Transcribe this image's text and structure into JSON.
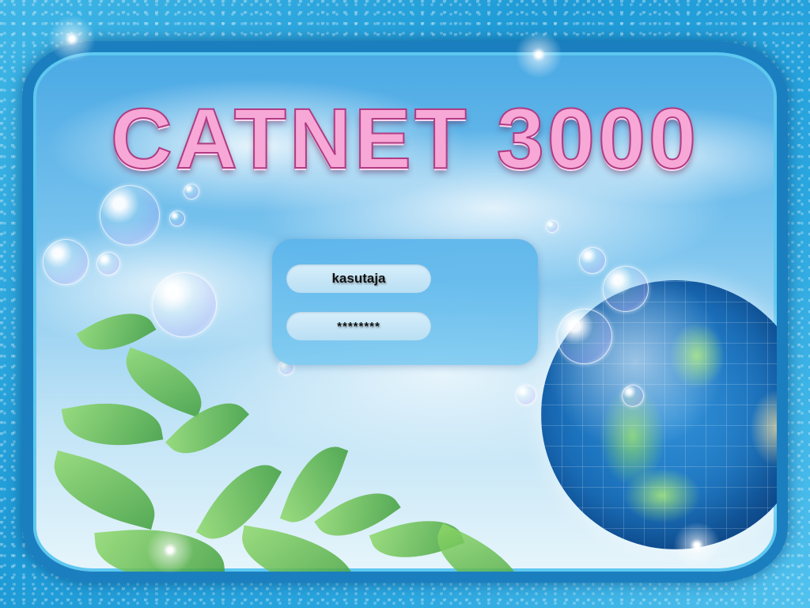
{
  "app": {
    "title": "CATNET 3000"
  },
  "login": {
    "username_value": "kasutaja",
    "password_value": "********"
  },
  "colors": {
    "title_fill": "#f7a8d6",
    "title_stroke": "#b03c84",
    "frame": "#1b7fbf",
    "panel": "#5ab4eb"
  }
}
